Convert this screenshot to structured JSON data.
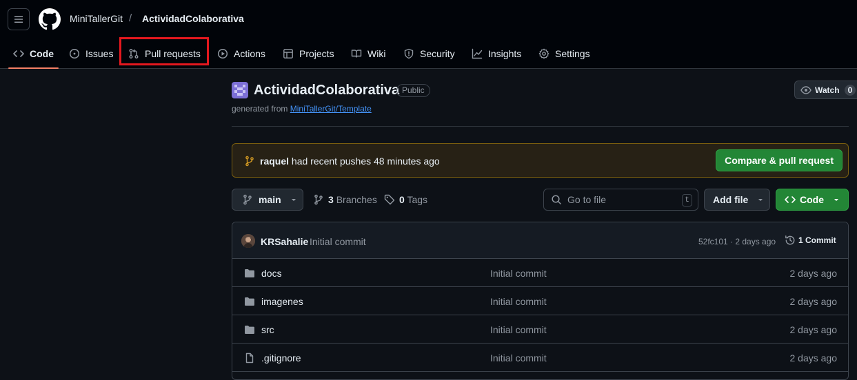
{
  "header": {
    "owner": "MiniTallerGit",
    "separator": "/",
    "repo": "ActividadColaborativa"
  },
  "tabs": [
    {
      "label": "Code",
      "icon": "code-icon",
      "active": true
    },
    {
      "label": "Issues",
      "icon": "issue-opened-icon"
    },
    {
      "label": "Pull requests",
      "icon": "git-pull-request-icon",
      "highlighted": true
    },
    {
      "label": "Actions",
      "icon": "play-icon"
    },
    {
      "label": "Projects",
      "icon": "table-icon"
    },
    {
      "label": "Wiki",
      "icon": "book-icon"
    },
    {
      "label": "Security",
      "icon": "shield-icon"
    },
    {
      "label": "Insights",
      "icon": "graph-icon"
    },
    {
      "label": "Settings",
      "icon": "gear-icon"
    }
  ],
  "repo": {
    "name": "ActividadColaborativa",
    "visibility": "Public",
    "generated_prefix": "generated from",
    "generated_from": "MiniTallerGit/Template",
    "watch_label": "Watch",
    "watch_count": "0"
  },
  "push_banner": {
    "user": "raquel",
    "text": "had recent pushes 48 minutes ago",
    "button": "Compare & pull request"
  },
  "toolbar": {
    "branch": "main",
    "branches_count": "3",
    "branches_label": "Branches",
    "tags_count": "0",
    "tags_label": "Tags",
    "search_placeholder": "Go to file",
    "search_shortcut": "t",
    "add_file": "Add file",
    "code_button": "Code"
  },
  "latest_commit": {
    "author": "KRSahalie",
    "message": "Initial commit",
    "meta": "52fc101 · 2 days ago",
    "count_label": "1 Commit"
  },
  "files": [
    {
      "name": "docs",
      "type": "folder",
      "message": "Initial commit",
      "date": "2 days ago"
    },
    {
      "name": "imagenes",
      "type": "folder",
      "message": "Initial commit",
      "date": "2 days ago"
    },
    {
      "name": "src",
      "type": "folder",
      "message": "Initial commit",
      "date": "2 days ago"
    },
    {
      "name": ".gitignore",
      "type": "file",
      "message": "Initial commit",
      "date": "2 days ago"
    }
  ],
  "colors": {
    "accent_green": "#238636",
    "active_tab_underline": "#f78166",
    "highlight_box": "#e5181e",
    "link_blue": "#4493f8"
  }
}
